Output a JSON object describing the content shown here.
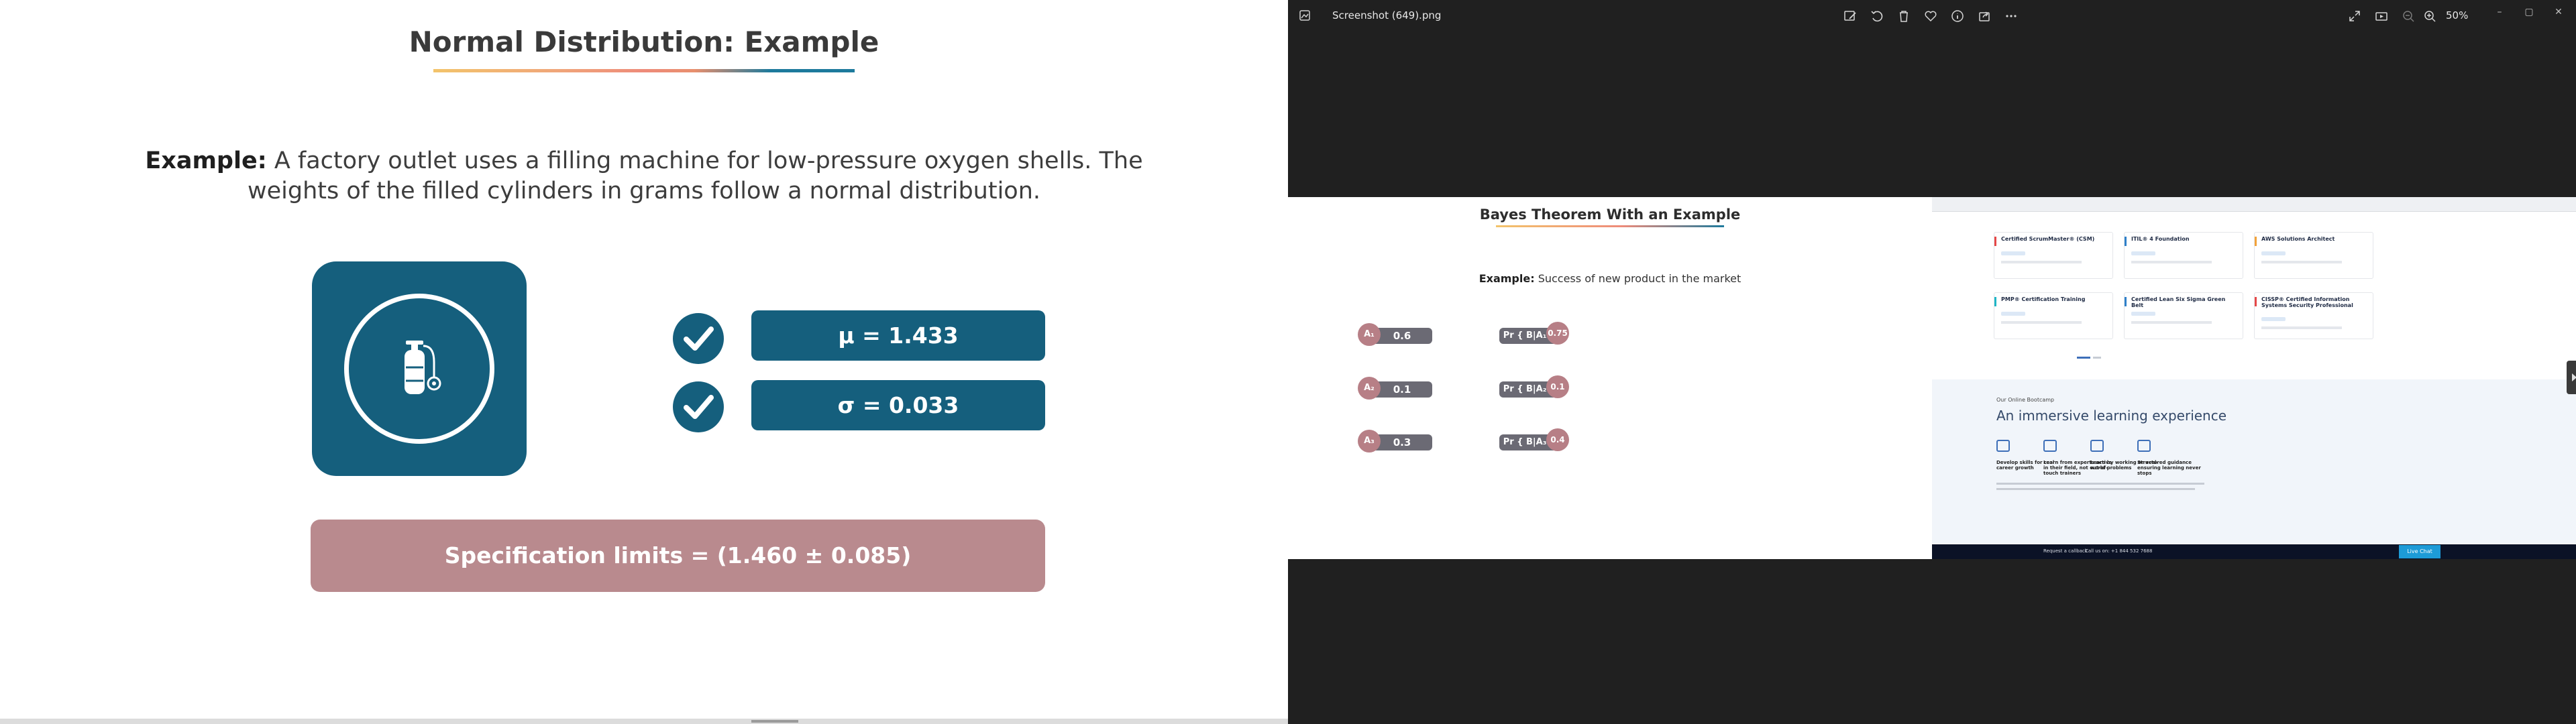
{
  "slide": {
    "title": "Normal Distribution: Example",
    "example_label": "Example:",
    "example_text": " A factory outlet uses a filling machine for low-pressure oxygen shells. The weights of the filled cylinders in grams follow a normal distribution.",
    "icon": "oxygen-cylinder-icon",
    "stats": [
      {
        "icon": "check-icon",
        "label": "μ = 1.433"
      },
      {
        "icon": "check-icon",
        "label": "σ = 0.033"
      }
    ],
    "spec_limits": "Specification limits = (1.460 ± 0.085)",
    "colors": {
      "teal": "#155f7d",
      "rose": "#b98a8e",
      "title": "#3a3a3a"
    }
  },
  "viewer": {
    "file_name": "Screenshot (649).png",
    "zoom": "50%",
    "toolbar_icons": [
      "edit-image-icon",
      "rotate-icon",
      "delete-icon",
      "favorite-icon",
      "info-icon",
      "share-icon",
      "more-icon"
    ],
    "right_icons": [
      "fullscreen-icon",
      "slideshow-icon",
      "zoom-out-icon",
      "zoom-in-icon"
    ],
    "window_controls": [
      "–",
      "▢",
      "✕"
    ],
    "shot": {
      "title": "Bayes Theorem With an Example",
      "example_label": "Example:",
      "example_text": " Success of new product in the market",
      "priors": [
        {
          "label": "A₁",
          "value": "0.6"
        },
        {
          "label": "A₂",
          "value": "0.1"
        },
        {
          "label": "A₃",
          "value": "0.3"
        }
      ],
      "likelihoods": [
        {
          "label": "Pr { B|A₁ }",
          "value": "0.75"
        },
        {
          "label": "Pr { B|A₂ }",
          "value": "0.1"
        },
        {
          "label": "Pr { B|A₃ }",
          "value": "0.4"
        }
      ],
      "web": {
        "courses": [
          {
            "name": "Certified ScrumMaster® (CSM)",
            "color": "#e54848"
          },
          {
            "name": "ITIL® 4 Foundation",
            "color": "#2f80c9"
          },
          {
            "name": "AWS Solutions Architect",
            "color": "#f2a23a"
          },
          {
            "name": "PMP® Certification Training",
            "color": "#1fb6c6"
          },
          {
            "name": "Certified Lean Six Sigma Green Belt",
            "color": "#2f80c9"
          },
          {
            "name": "CISSP® Certified Information Systems Security Professional",
            "color": "#e54848"
          }
        ],
        "kicker": "Our Online Bootcamp",
        "heading": "An immersive learning experience",
        "features": [
          "Develop skills for real career growth",
          "Learn from experts active in their field, not out-of-touch trainers",
          "Learn by working on real-world problems",
          "Structured guidance ensuring learning never stops"
        ],
        "footer": [
          "Request a callback",
          "Call us on: +1 844 532 7688",
          "Live Chat"
        ]
      }
    }
  }
}
